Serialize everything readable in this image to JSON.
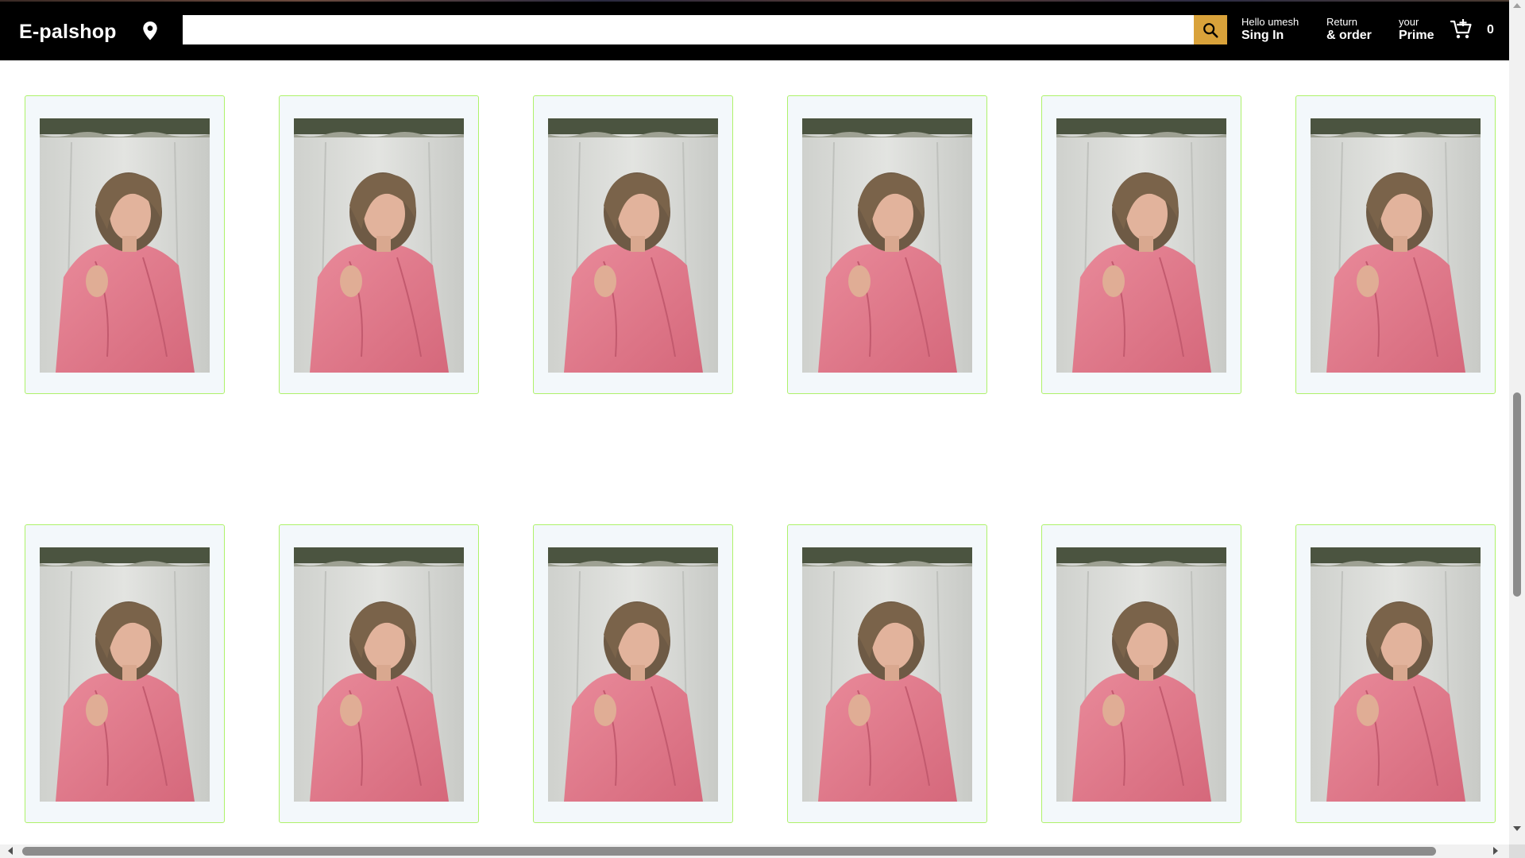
{
  "header": {
    "logo": "E-palshop",
    "location_icon": "map-pin-icon",
    "search": {
      "value": "",
      "placeholder": ""
    },
    "search_icon": "search-icon",
    "signin": {
      "small": "Hello umesh",
      "big": "Sing In"
    },
    "orders": {
      "small": "Return",
      "big": "& order"
    },
    "prime": {
      "small": "your",
      "big": "Prime"
    },
    "cart_icon": "cart-add-icon",
    "cart_count": "0"
  },
  "products": {
    "rows": 2,
    "per_row": 6,
    "image_subject": "woman in pink shirt"
  },
  "colors": {
    "header_bg": "#000000",
    "search_button": "#d9a23a",
    "card_border": "#aef26a",
    "card_bg": "#f3f8fb"
  }
}
